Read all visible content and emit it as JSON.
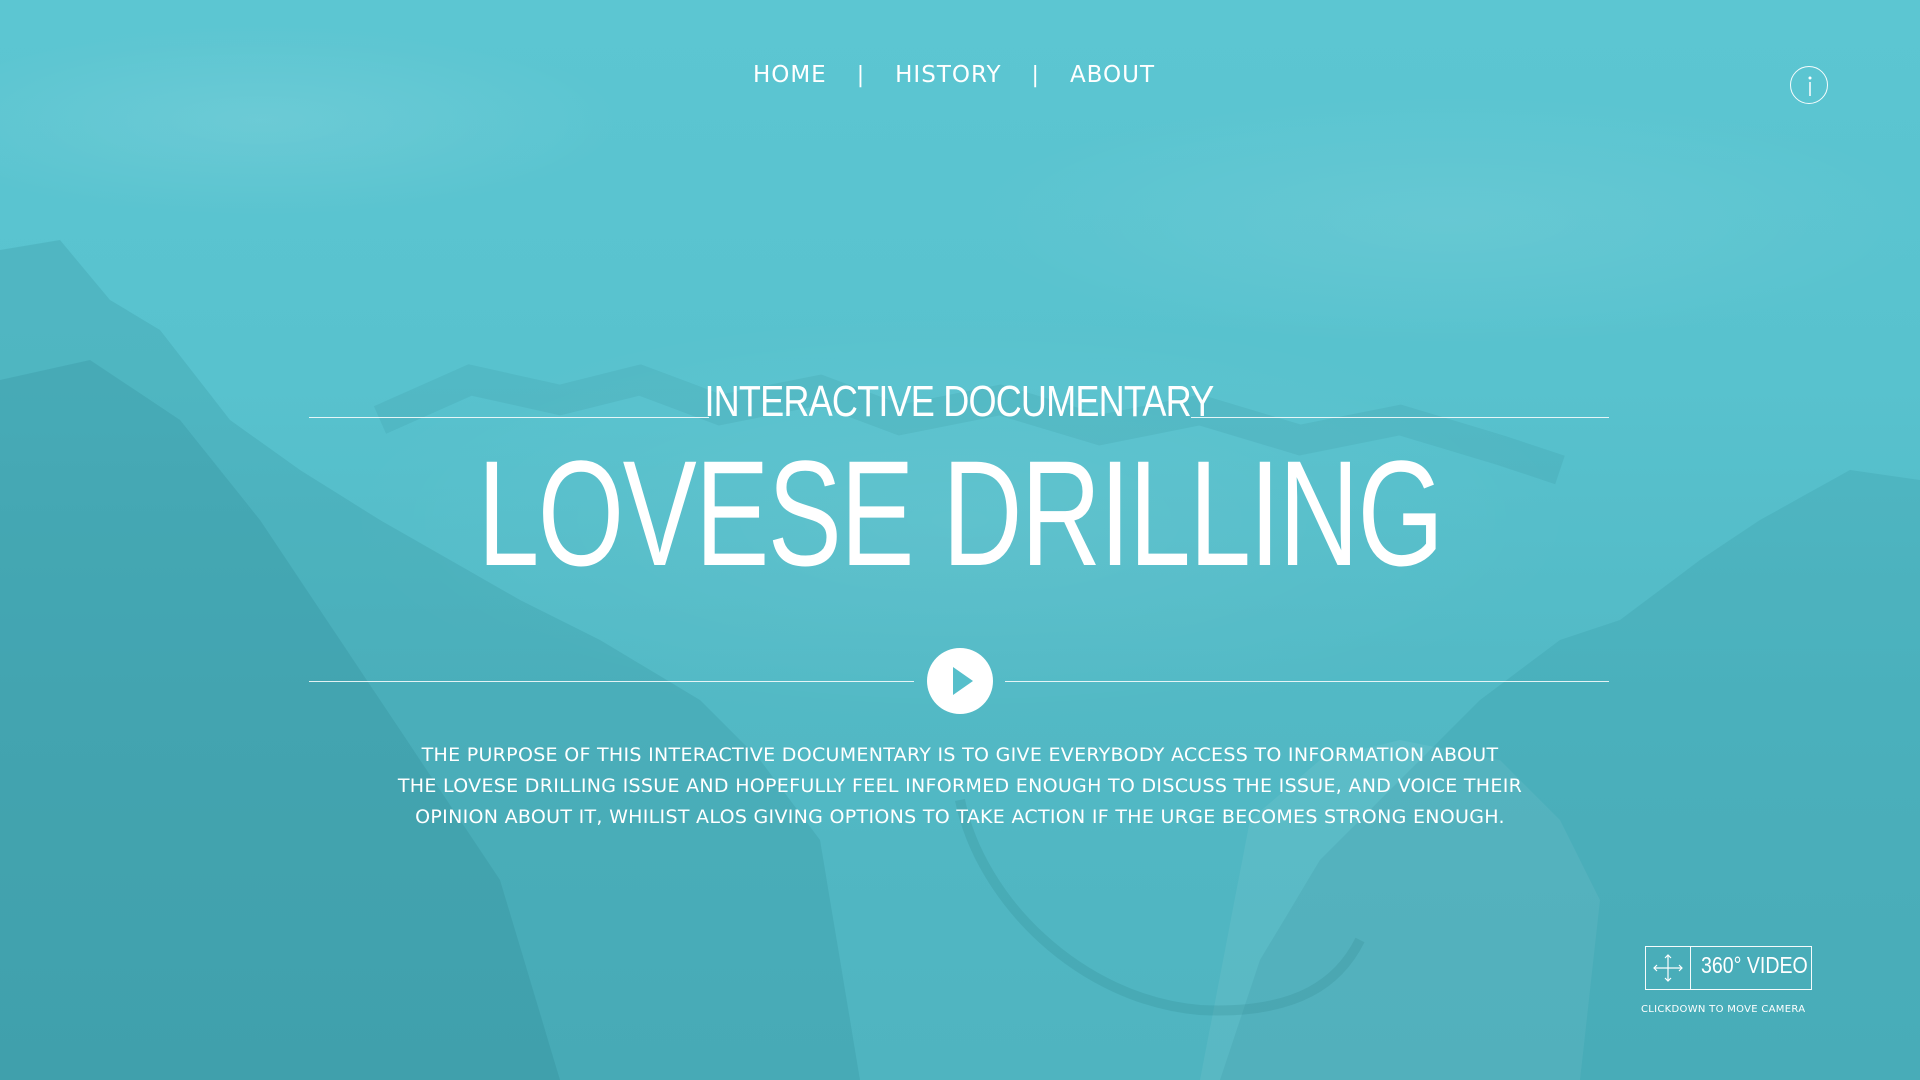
{
  "nav": {
    "items": [
      {
        "label": "HOME"
      },
      {
        "label": "HISTORY"
      },
      {
        "label": "ABOUT"
      }
    ],
    "separator": "|"
  },
  "info_icon": "info-icon",
  "hero": {
    "subtitle": "INTERACTIVE DOCUMENTARY",
    "title": "LOVESE DRILLING",
    "play_icon": "play-icon",
    "description_lines": [
      "THE PURPOSE OF THIS INTERACTIVE DOCUMENTARY IS TO GIVE EVERYBODY ACCESS TO INFORMATION ABOUT",
      "THE LOVESE DRILLING ISSUE AND HOPEFULLY FEEL INFORMED ENOUGH TO DISCUSS THE ISSUE, AND VOICE THEIR",
      "OPINION ABOUT IT, WHILIST ALOS GIVING OPTIONS TO TAKE ACTION IF THE URGE BECOMES STRONG ENOUGH."
    ]
  },
  "video_widget": {
    "icon": "move-arrows-icon",
    "label": "360° VIDEO",
    "hint": "CLICKDOWN TO MOVE CAMERA"
  },
  "colors": {
    "overlay": "#56bfcb",
    "text": "#ffffff"
  }
}
